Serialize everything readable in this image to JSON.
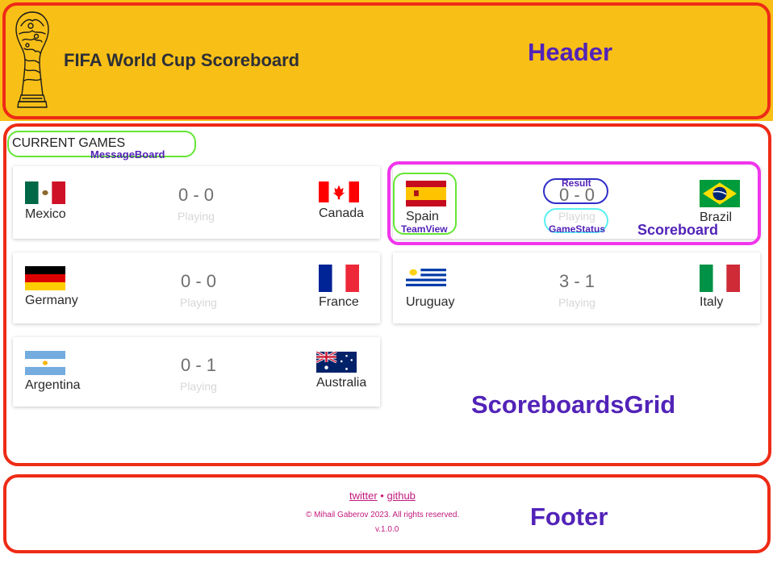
{
  "header": {
    "title": "FIFA World Cup Scoreboard",
    "zone_label": "Header",
    "logo_icon": "world-cup-trophy-icon"
  },
  "message_board": {
    "title": "CURRENT GAMES",
    "zone_label": "MessageBoard"
  },
  "games": [
    {
      "home": {
        "name": "Mexico",
        "flag": "mexico-flag-icon"
      },
      "away": {
        "name": "Canada",
        "flag": "canada-flag-icon"
      },
      "score": "0 - 0",
      "status": "Playing"
    },
    {
      "home": {
        "name": "Spain",
        "flag": "spain-flag-icon"
      },
      "away": {
        "name": "Brazil",
        "flag": "brazil-flag-icon"
      },
      "score": "0 - 0",
      "status": "Playing"
    },
    {
      "home": {
        "name": "Germany",
        "flag": "germany-flag-icon"
      },
      "away": {
        "name": "France",
        "flag": "france-flag-icon"
      },
      "score": "0 - 0",
      "status": "Playing"
    },
    {
      "home": {
        "name": "Uruguay",
        "flag": "uruguay-flag-icon"
      },
      "away": {
        "name": "Italy",
        "flag": "italy-flag-icon"
      },
      "score": "3 - 1",
      "status": "Playing"
    },
    {
      "home": {
        "name": "Argentina",
        "flag": "argentina-flag-icon"
      },
      "away": {
        "name": "Australia",
        "flag": "australia-flag-icon"
      },
      "score": "0 - 1",
      "status": "Playing"
    }
  ],
  "annotations": {
    "scoreboard": "Scoreboard",
    "team_view": "TeamView",
    "result": "Result",
    "game_status": "GameStatus",
    "scoreboards_grid": "ScoreboardsGrid",
    "footer": "Footer"
  },
  "footer": {
    "twitter": "twitter",
    "separator": "•",
    "github": "github",
    "copyright": "© Mihail Gaberov 2023. All rights reserved.",
    "version": "v.1.0.0"
  },
  "colors": {
    "header_bg": "#f8bf17",
    "zone_border": "#ee2b16",
    "annotation_text": "#5223b8",
    "message_board_border": "#65e635",
    "scoreboard_border": "#f035ec",
    "result_border": "#2e2dc8",
    "game_status_border": "#5cf0f2",
    "footer_link": "#c2187d"
  }
}
